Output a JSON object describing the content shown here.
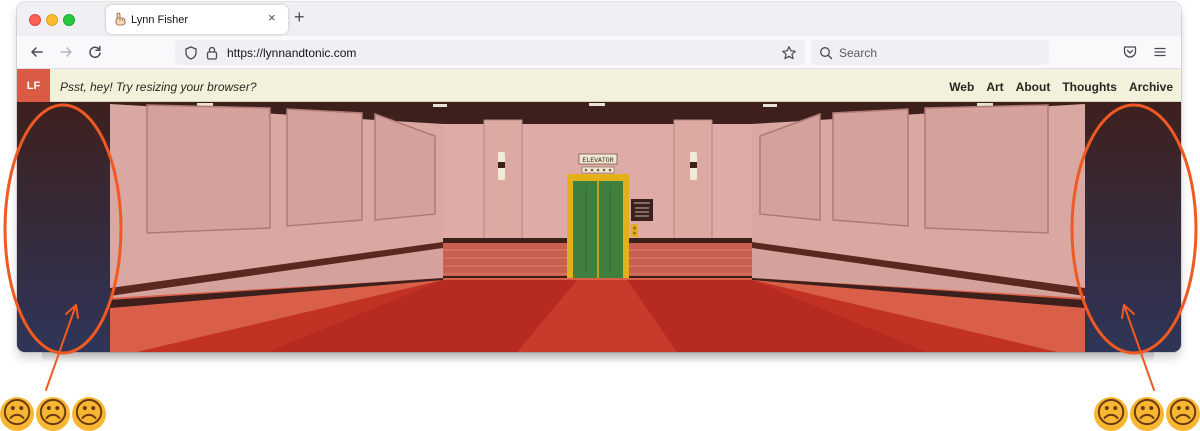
{
  "browser": {
    "tab": {
      "title": "Lynn Fisher",
      "close_icon": "×",
      "new_tab_icon": "+"
    },
    "url": "https://lynnandtonic.com",
    "search_placeholder": "Search"
  },
  "site": {
    "logo": "LF",
    "tagline": "Psst, hey! Try resizing your browser?",
    "nav": [
      "Web",
      "Art",
      "About",
      "Thoughts",
      "Archive"
    ],
    "elevator_sign": "ELEVATOR"
  },
  "annotations": {
    "left_faces": [
      "☹",
      "☹",
      "☹"
    ],
    "right_faces": [
      "☹",
      "☹",
      "☹"
    ],
    "colors": {
      "circle": "#f05a22",
      "face": "#f7b733"
    }
  }
}
